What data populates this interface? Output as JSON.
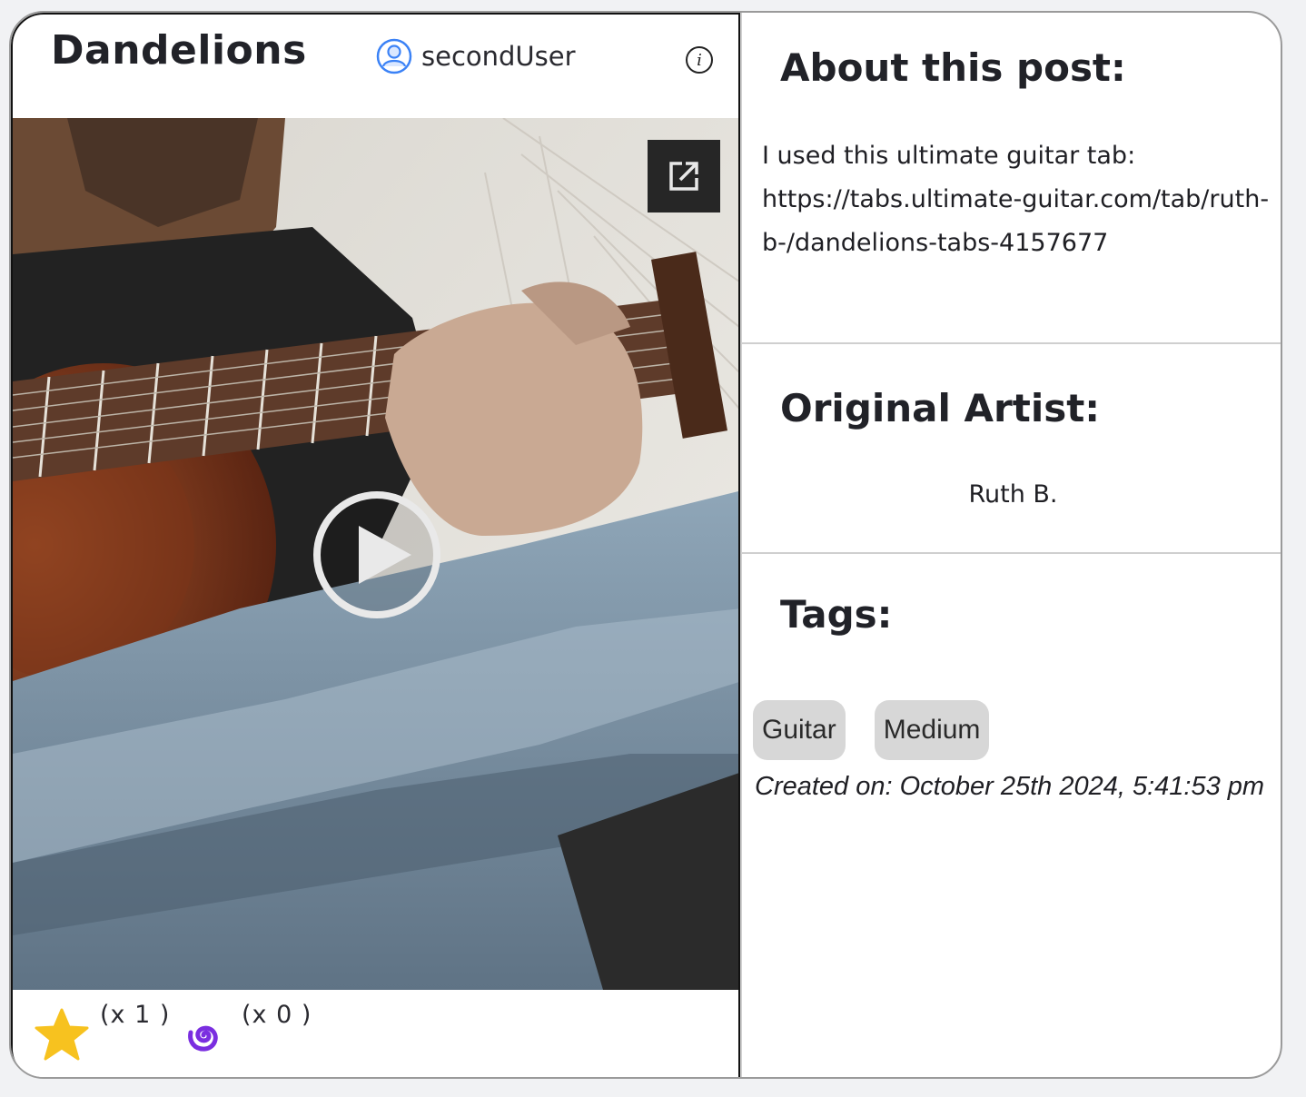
{
  "post": {
    "title": "Dandelions",
    "username": "secondUser"
  },
  "video": {
    "thumbnail": "person playing acoustic guitar, seated cross-legged in jeans"
  },
  "reactions": [
    {
      "icon": "star-icon",
      "count_label": "(x 1 )",
      "color": "#f7c21f"
    },
    {
      "icon": "spiral-icon",
      "count_label": "(x 0 )",
      "color": "#7a2ee0"
    }
  ],
  "about": {
    "heading": "About this post:",
    "text": "I used this ultimate guitar tab: https://tabs.ultimate-guitar.com/tab/ruth-b-/dandelions-tabs-4157677"
  },
  "artist": {
    "heading": "Original Artist:",
    "name": "Ruth B."
  },
  "tags": {
    "heading": "Tags:",
    "items": [
      "Guitar",
      "Medium"
    ]
  },
  "created": "Created on: October 25th 2024, 5:41:53 pm",
  "colors": {
    "user_icon": "#3b82f6",
    "tag_bg": "#d7d7d7",
    "card_border": "#9a9a9a"
  }
}
